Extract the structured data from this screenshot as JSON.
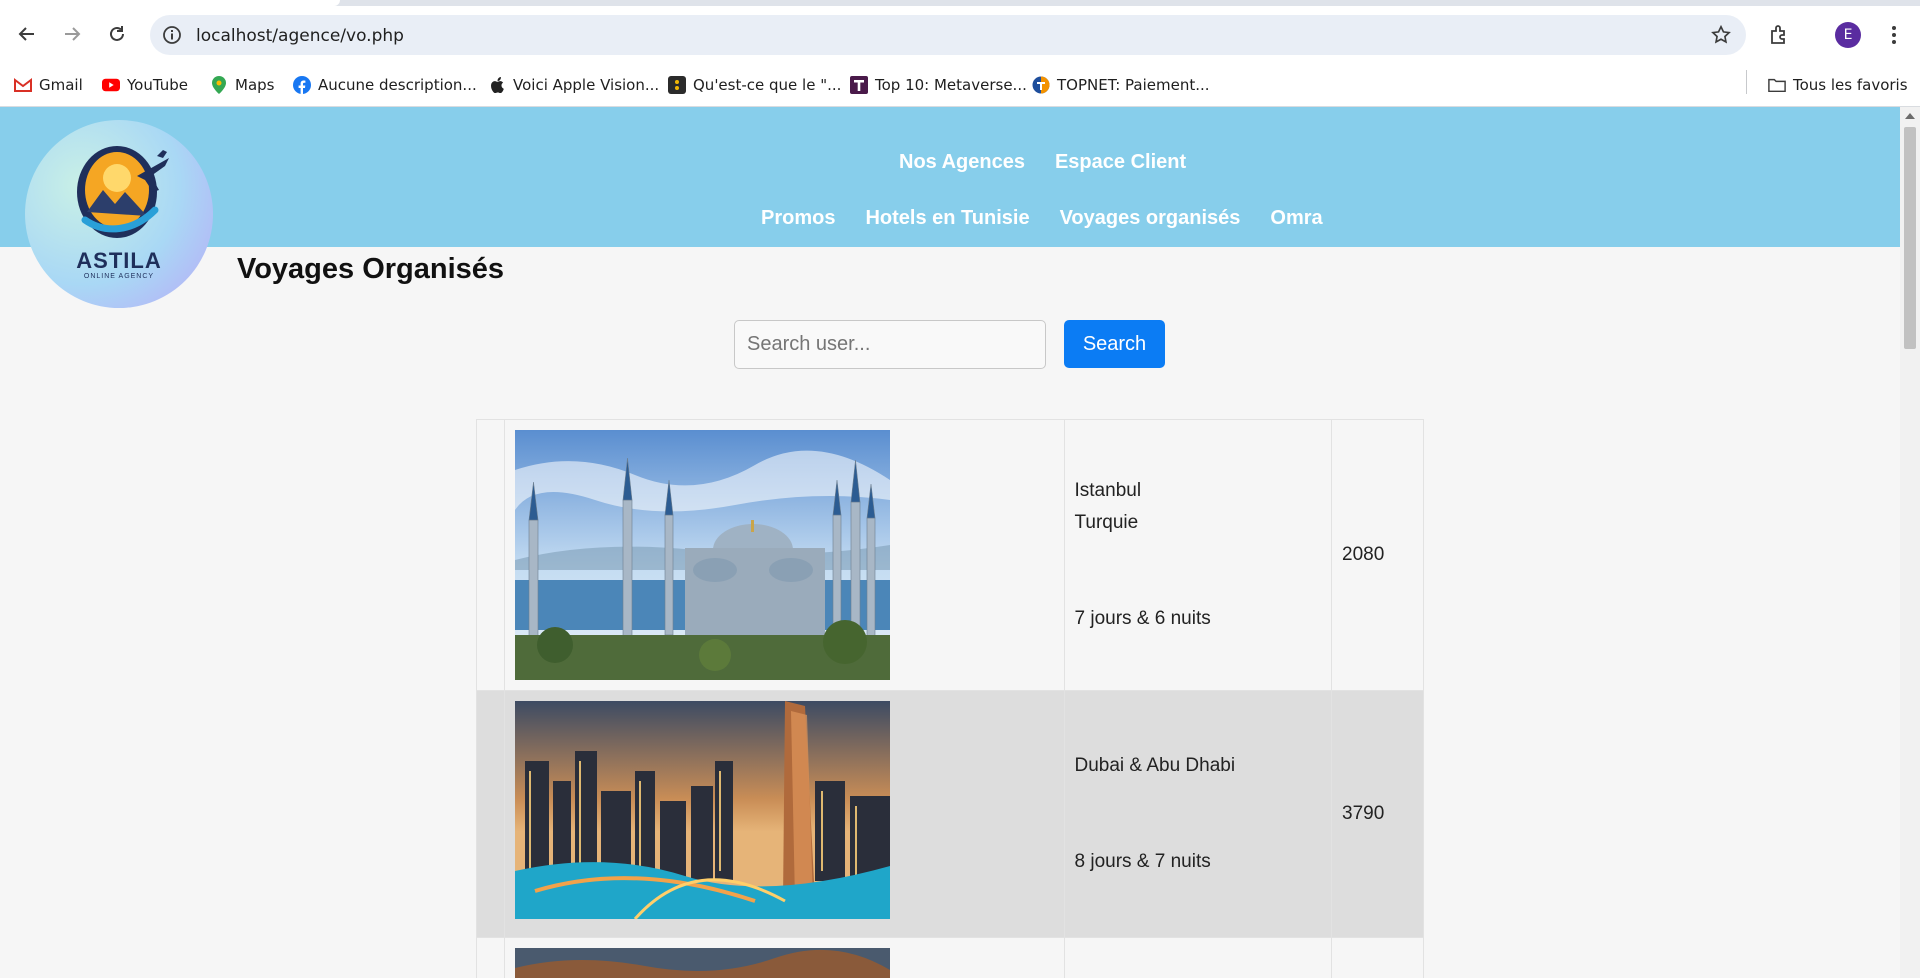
{
  "browser": {
    "url": "localhost/agence/vo.php",
    "profile_initial": "E",
    "bookmarks": [
      {
        "label": "Gmail",
        "icon": "gmail-icon"
      },
      {
        "label": "YouTube",
        "icon": "youtube-icon"
      },
      {
        "label": "Maps",
        "icon": "maps-icon"
      },
      {
        "label": "Aucune description...",
        "icon": "facebook-icon"
      },
      {
        "label": "Voici Apple Vision...",
        "icon": "apple-icon"
      },
      {
        "label": "Qu'est-ce que le \"...",
        "icon": "dots-icon"
      },
      {
        "label": "Top 10: Metaverse...",
        "icon": "t-icon"
      },
      {
        "label": "TOPNET: Paiement...",
        "icon": "topnet-icon"
      }
    ],
    "all_bookmarks_label": "Tous les favoris"
  },
  "site": {
    "logo_title": "ASTILA",
    "logo_subtitle": "ONLINE AGENCY",
    "nav_top": [
      "Nos Agences",
      "Espace Client"
    ],
    "nav_bottom": [
      "Promos",
      "Hotels en Tunisie",
      "Voyages organisés",
      "Omra"
    ]
  },
  "page": {
    "title": "Voyages Organisés",
    "search_placeholder": "Search user...",
    "search_button": "Search"
  },
  "trips": [
    {
      "line1": "Istanbul",
      "line2": "Turquie",
      "duration": "7 jours & 6 nuits",
      "price": "2080",
      "image": "blue-mosque-photo"
    },
    {
      "line1": "Dubai & Abu Dhabi",
      "line2": "",
      "duration": "8 jours & 7 nuits",
      "price": "3790",
      "image": "dubai-marina-photo"
    }
  ],
  "colors": {
    "header_bg": "#87ceeb",
    "search_button_bg": "#0b7cf4",
    "alt_row_bg": "#dddddd"
  }
}
